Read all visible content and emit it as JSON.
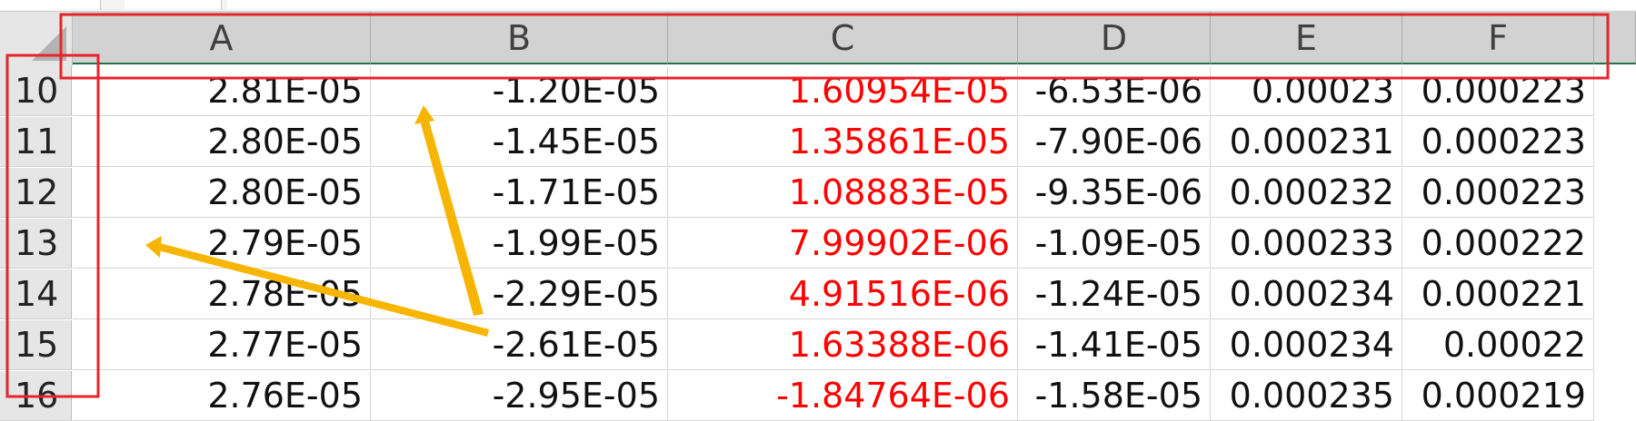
{
  "columns": [
    "A",
    "B",
    "C",
    "D",
    "E",
    "F"
  ],
  "rows": [
    {
      "row": "10",
      "cells": [
        "2.81E-05",
        "-1.20E-05",
        "1.60954E-05",
        "-6.53E-06",
        "0.00023",
        "0.000223"
      ]
    },
    {
      "row": "11",
      "cells": [
        "2.80E-05",
        "-1.45E-05",
        "1.35861E-05",
        "-7.90E-06",
        "0.000231",
        "0.000223"
      ]
    },
    {
      "row": "12",
      "cells": [
        "2.80E-05",
        "-1.71E-05",
        "1.08883E-05",
        "-9.35E-06",
        "0.000232",
        "0.000223"
      ]
    },
    {
      "row": "13",
      "cells": [
        "2.79E-05",
        "-1.99E-05",
        "7.99902E-06",
        "-1.09E-05",
        "0.000233",
        "0.000222"
      ]
    },
    {
      "row": "14",
      "cells": [
        "2.78E-05",
        "-2.29E-05",
        "4.91516E-06",
        "-1.24E-05",
        "0.000234",
        "0.000221"
      ]
    },
    {
      "row": "15",
      "cells": [
        "2.77E-05",
        "-2.61E-05",
        "1.63388E-06",
        "-1.41E-05",
        "0.000234",
        "0.00022"
      ]
    },
    {
      "row": "16",
      "cells": [
        "2.76E-05",
        "-2.95E-05",
        "-1.84764E-06",
        "-1.58E-05",
        "0.000235",
        "0.000219"
      ]
    }
  ],
  "colors": {
    "highlight_text": "#ff0000",
    "annotation_box": "#e8242b",
    "annotation_arrow": "#f7b500",
    "header_underline": "#217346"
  }
}
